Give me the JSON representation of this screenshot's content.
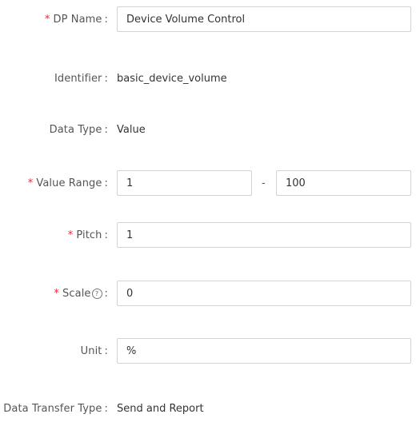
{
  "form": {
    "dp_name": {
      "label": "DP Name",
      "required": true,
      "value": "Device Volume Control"
    },
    "identifier": {
      "label": "Identifier",
      "value": "basic_device_volume"
    },
    "data_type": {
      "label": "Data Type",
      "value": "Value"
    },
    "value_range": {
      "label": "Value Range",
      "required": true,
      "min": "1",
      "separator": "-",
      "max": "100"
    },
    "pitch": {
      "label": "Pitch",
      "required": true,
      "value": "1"
    },
    "scale": {
      "label": "Scale",
      "required": true,
      "help_icon": "question-circle-icon",
      "help_glyph": "?",
      "value": "0"
    },
    "unit": {
      "label": "Unit",
      "value": "%"
    },
    "data_transfer_type": {
      "label": "Data Transfer Type",
      "value": "Send and Report"
    },
    "required_mark": "*",
    "colon": ":"
  },
  "colors": {
    "required": "#f5222d",
    "label": "#555555",
    "text": "#333333",
    "border": "#d3d3d3"
  }
}
